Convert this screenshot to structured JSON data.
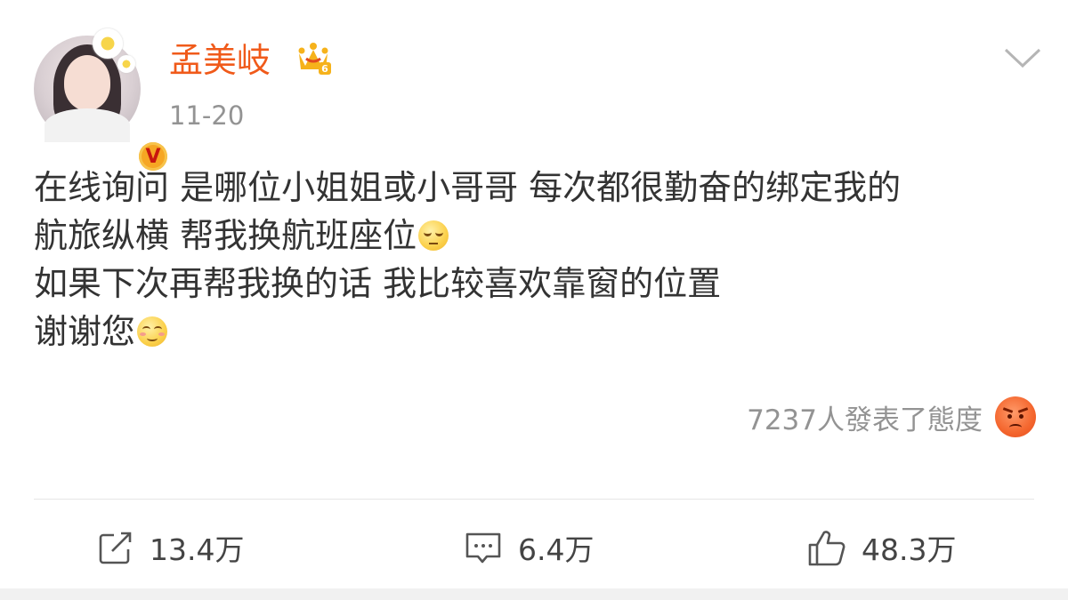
{
  "post_header": {
    "username": "孟美岐",
    "timestamp": "11-20",
    "crown_level": "6",
    "verified_badge": "V"
  },
  "post_body": {
    "lines": [
      "在线询问 是哪位小姐姐或小哥哥 每次都很勤奋的绑定我的",
      "航旅纵横 帮我换航班座位",
      "如果下次再帮我换的话 我比较喜欢靠窗的位置",
      "谢谢您"
    ],
    "emojis": [
      "roll-eyes-emoji",
      "smile-emoji"
    ]
  },
  "reactions": {
    "summary": "7237人發表了態度",
    "icon": "angry-emoji"
  },
  "actions": {
    "repost": {
      "icon": "repost-icon",
      "count": "13.4万"
    },
    "comment": {
      "icon": "comment-icon",
      "count": "6.4万"
    },
    "like": {
      "icon": "thumbs-up-icon",
      "count": "48.3万"
    }
  },
  "colors": {
    "username": "#f05a1a",
    "muted": "#939393",
    "text": "#333333"
  }
}
